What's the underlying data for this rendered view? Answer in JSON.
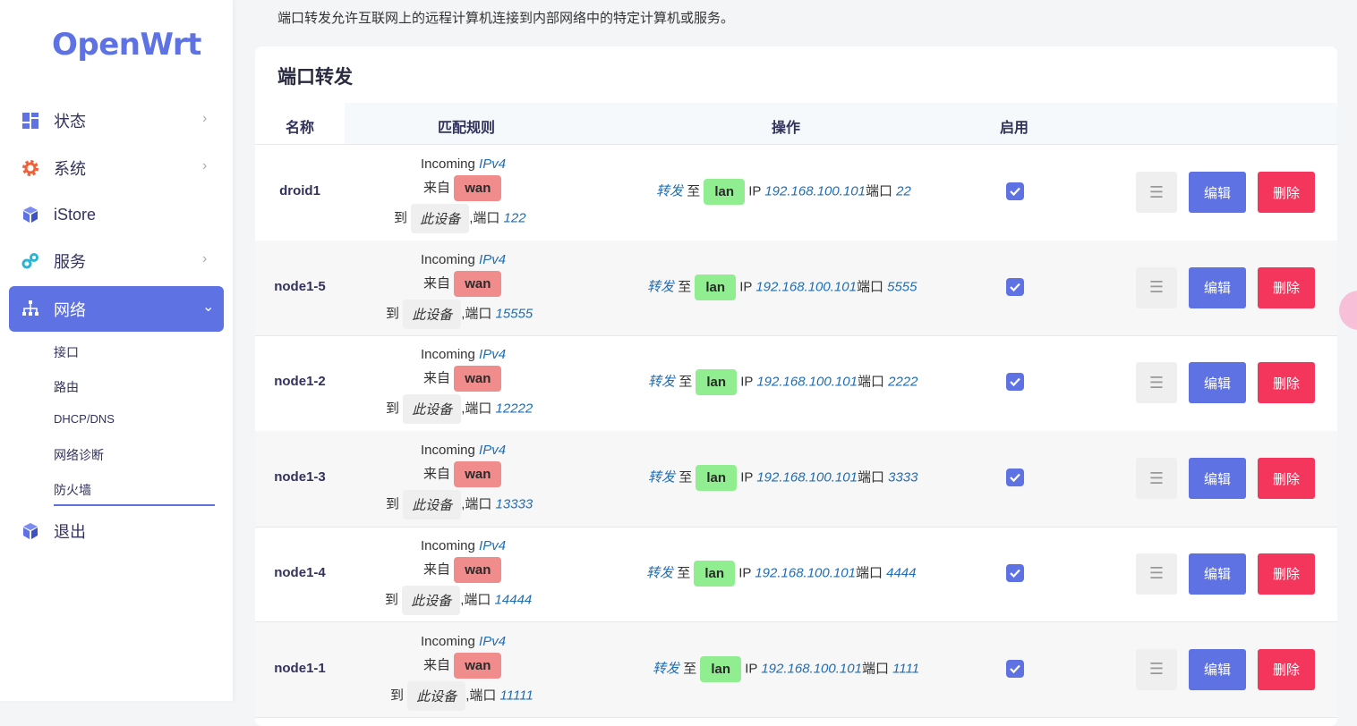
{
  "sidebar": {
    "logo": "OpenWrt",
    "items": [
      {
        "label": "状态",
        "icon": "dashboard-icon",
        "chevron": true
      },
      {
        "label": "系统",
        "icon": "gear-icon",
        "chevron": true
      },
      {
        "label": "iStore",
        "icon": "cube-icon",
        "chevron": false
      },
      {
        "label": "服务",
        "icon": "puzzle-icon",
        "chevron": true
      },
      {
        "label": "网络",
        "icon": "network-icon",
        "chevron": true,
        "active": true
      },
      {
        "label": "退出",
        "icon": "cube-icon",
        "chevron": false
      }
    ],
    "submenu": [
      "接口",
      "路由",
      "DHCP/DNS",
      "网络诊断",
      "防火墙"
    ]
  },
  "page": {
    "description": "端口转发允许互联网上的远程计算机连接到内部网络中的特定计算机或服务。",
    "section_title": "端口转发",
    "columns": [
      "名称",
      "匹配规则",
      "操作",
      "启用"
    ]
  },
  "labels": {
    "incoming": "Incoming",
    "ipv4": "IPv4",
    "from": "来自",
    "to": "到",
    "this_device": "此设备",
    "port_sep": ",端口",
    "forward": "转发",
    "to_zone": "至",
    "ip": "IP",
    "port": "端口",
    "menu_btn": "☰",
    "edit": "编辑",
    "delete": "删除"
  },
  "rules": [
    {
      "name": "droid1",
      "src_zone": "wan",
      "src_port": "122",
      "dest_zone": "lan",
      "dest_ip": "192.168.100.101",
      "dest_port": "22",
      "enabled": true
    },
    {
      "name": "node1-5",
      "src_zone": "wan",
      "src_port": "15555",
      "dest_zone": "lan",
      "dest_ip": "192.168.100.101",
      "dest_port": "5555",
      "enabled": true
    },
    {
      "name": "node1-2",
      "src_zone": "wan",
      "src_port": "12222",
      "dest_zone": "lan",
      "dest_ip": "192.168.100.101",
      "dest_port": "2222",
      "enabled": true
    },
    {
      "name": "node1-3",
      "src_zone": "wan",
      "src_port": "13333",
      "dest_zone": "lan",
      "dest_ip": "192.168.100.101",
      "dest_port": "3333",
      "enabled": true
    },
    {
      "name": "node1-4",
      "src_zone": "wan",
      "src_port": "14444",
      "dest_zone": "lan",
      "dest_ip": "192.168.100.101",
      "dest_port": "4444",
      "enabled": true
    },
    {
      "name": "node1-1",
      "src_zone": "wan",
      "src_port": "11111",
      "dest_zone": "lan",
      "dest_ip": "192.168.100.101",
      "dest_port": "1111",
      "enabled": true
    }
  ],
  "colors": {
    "accent": "#5e72e4",
    "danger": "#f5365c",
    "wan": "#f08c8c",
    "lan": "#90ee90"
  }
}
